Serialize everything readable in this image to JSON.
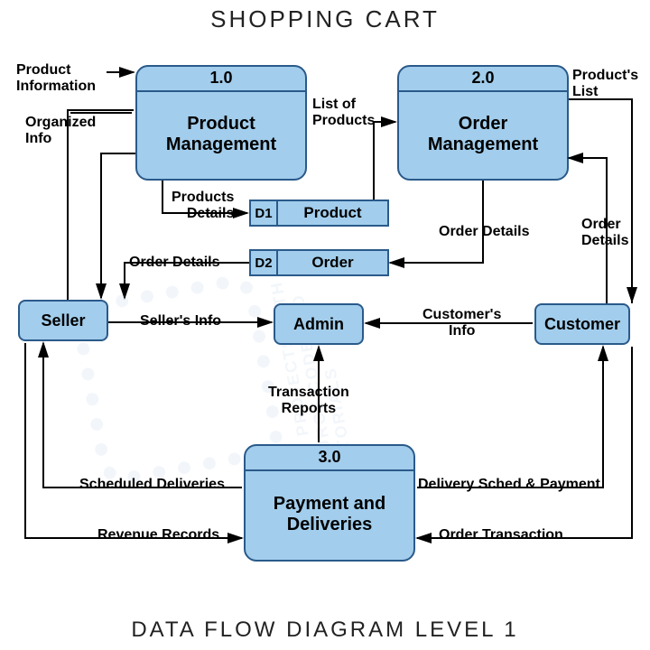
{
  "title": "SHOPPING CART",
  "footer": "DATA FLOW DIAGRAM LEVEL 1",
  "processes": {
    "p1": {
      "id": "1.0",
      "name": "Product Management"
    },
    "p2": {
      "id": "2.0",
      "name": "Order Management"
    },
    "p3": {
      "id": "3.0",
      "name": "Payment and Deliveries"
    }
  },
  "entities": {
    "seller": "Seller",
    "admin": "Admin",
    "customer": "Customer"
  },
  "datastores": {
    "d1": {
      "id": "D1",
      "name": "Product"
    },
    "d2": {
      "id": "D2",
      "name": "Order"
    }
  },
  "flows": {
    "product_information": "Product\nInformation",
    "organized_info": "Organized\nInfo",
    "products_details": "Products\nDetails",
    "list_of_products": "List of\nProducts",
    "products_list": "Product's\nList",
    "order_details_right": "Order Details",
    "order_details_far_right": "Order\nDetails",
    "order_details_left": "Order Details",
    "sellers_info": "Seller's Info",
    "customers_info": "Customer's\nInfo",
    "transaction_reports": "Transaction\nReports",
    "scheduled_deliveries": "Scheduled Deliveries",
    "delivery_sched_payment": "Delivery Sched & Payment",
    "revenue_records": "Revenue Records",
    "order_transaction": "Order Transaction"
  }
}
